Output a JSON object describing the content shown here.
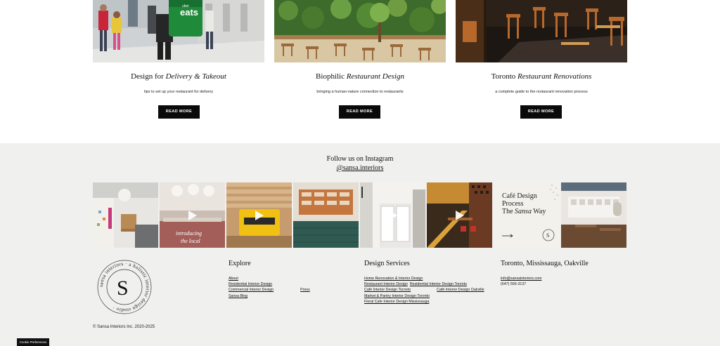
{
  "cards": [
    {
      "title_plain": "Design for ",
      "title_italic": "Delivery & Takeout",
      "subtitle": "tips to set up your restaurant for delivery",
      "button": "READ MORE"
    },
    {
      "title_plain": "Biophilic ",
      "title_italic": "Restaurant Design",
      "subtitle": "bringing a human-nature connection to restaurants",
      "button": "READ MORE"
    },
    {
      "title_plain": "Toronto ",
      "title_italic": "Restaurant Renovations",
      "subtitle": "a complete guide to the restaurant renovation process",
      "button": "READ MORE"
    }
  ],
  "card_photo_texts": {
    "eats": "eats",
    "uber": "uber"
  },
  "instagram": {
    "heading": "Follow us on Instagram",
    "handle": "@sansa.interiors",
    "tile_text_intro_1": "introducing",
    "tile_text_intro_2": "the local",
    "tile_cafe_1": "Café Design",
    "tile_cafe_2": "Process",
    "tile_cafe_3_plain": "The ",
    "tile_cafe_3_italic": "Sansa",
    "tile_cafe_3_end": " Way",
    "tile_cafe_badge": "S"
  },
  "logo": {
    "letter": "S",
    "ring_text": "sansa interiors · a holistic interior design studio ·"
  },
  "explore": {
    "heading": "Explore",
    "links": [
      "About",
      "Residential Interior Design",
      "Commercial Interior Design",
      "Sansa Blog"
    ],
    "press": "Press"
  },
  "services": {
    "heading": "Design Services",
    "line1": "Home Renovation & Interior Design",
    "line2a": "Restaurant Interior Design",
    "line2b": "Residential Interior Design Toronto",
    "line3a": "Café Interior Design Toronto",
    "line3b": "Café Interior Design Oakville",
    "line4": "Market & Pantry Interior Design Toronto",
    "line5": "Floral Cafe Interior Design Mississauga"
  },
  "contact": {
    "heading": "Toronto, Mississauga, Oakville",
    "email": "info@sansainteriors.com",
    "phone": "(647) 556-3137"
  },
  "copyright": "© Sansa Interiors Inc. 2020-2025",
  "cookie_button": "Cookie Preferences",
  "colors": {
    "footer_bg": "#f0f0ee",
    "button_bg": "#0a0a0a",
    "text": "#111111"
  }
}
